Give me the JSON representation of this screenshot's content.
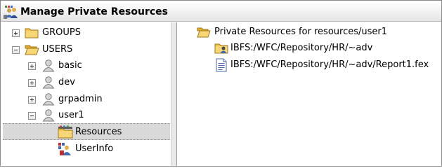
{
  "window": {
    "title": "Manage Private Resources",
    "app_icon": "users-keys-icon"
  },
  "tree": {
    "groups": {
      "label": "GROUPS",
      "expander": "plus",
      "icon": "folder-icon"
    },
    "users": {
      "label": "USERS",
      "expander": "minus",
      "icon": "folder-open-icon"
    },
    "basic": {
      "label": "basic",
      "expander": "plus",
      "icon": "user-icon"
    },
    "dev": {
      "label": "dev",
      "expander": "plus",
      "icon": "user-icon"
    },
    "grpadmin": {
      "label": "grpadmin",
      "expander": "plus",
      "icon": "user-icon"
    },
    "user1": {
      "label": "user1",
      "expander": "minus",
      "icon": "user-icon"
    },
    "resources": {
      "label": "Resources",
      "icon": "resources-folder-icon",
      "selected": true
    },
    "userinfo": {
      "label": "UserInfo",
      "icon": "userinfo-icon"
    }
  },
  "detail": {
    "header": "Private Resources for resources/user1",
    "items": [
      {
        "label": "IBFS:/WFC/Repository/HR/~adv",
        "icon": "shared-folder-icon"
      },
      {
        "label": "IBFS:/WFC/Repository/HR/~adv/Report1.fex",
        "icon": "document-icon"
      }
    ]
  },
  "colors": {
    "folder": "#f0c24a",
    "selection": "#d9d9d9",
    "user": "#9a9a9a"
  }
}
